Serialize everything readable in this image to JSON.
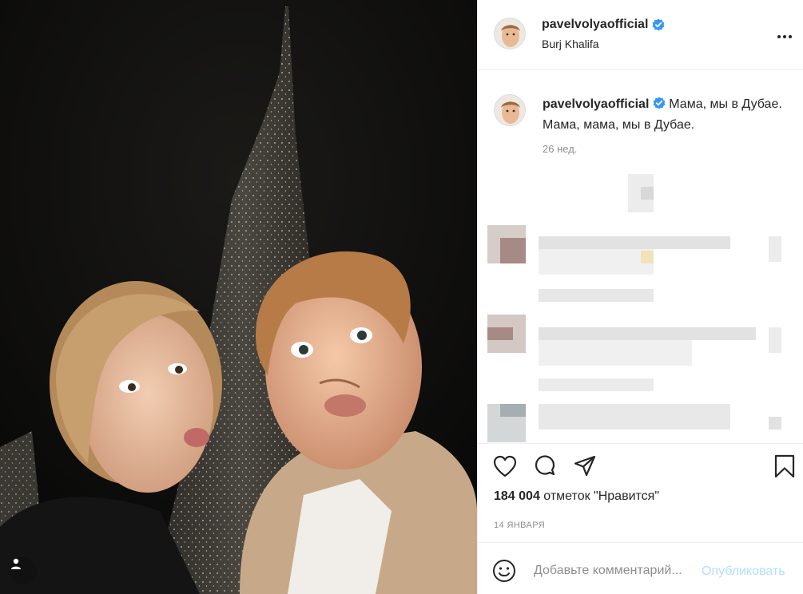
{
  "post": {
    "username": "pavelvolyaofficial",
    "location": "Burj Khalifa",
    "caption": "Мама, мы в Дубае. Мама, мама, мы в Дубае.",
    "time_ago": "26 нед.",
    "likes_count": "184 004",
    "likes_label": "отметок \"Нравится\"",
    "date": "14 января"
  },
  "comment_box": {
    "placeholder": "Добавьте комментарий...",
    "publish_label": "Опубликовать"
  },
  "icons": {
    "more": "more-icon",
    "verified": "verified-badge-icon",
    "like": "heart-icon",
    "comment": "comment-icon",
    "share": "share-icon",
    "save": "bookmark-icon",
    "emoji": "emoji-icon",
    "tagged_users": "user-tag-icon"
  },
  "colors": {
    "verified_blue": "#3897f0",
    "link_blue_disabled": "#b2dffc",
    "text": "#262626",
    "secondary_text": "#8e8e8e"
  }
}
